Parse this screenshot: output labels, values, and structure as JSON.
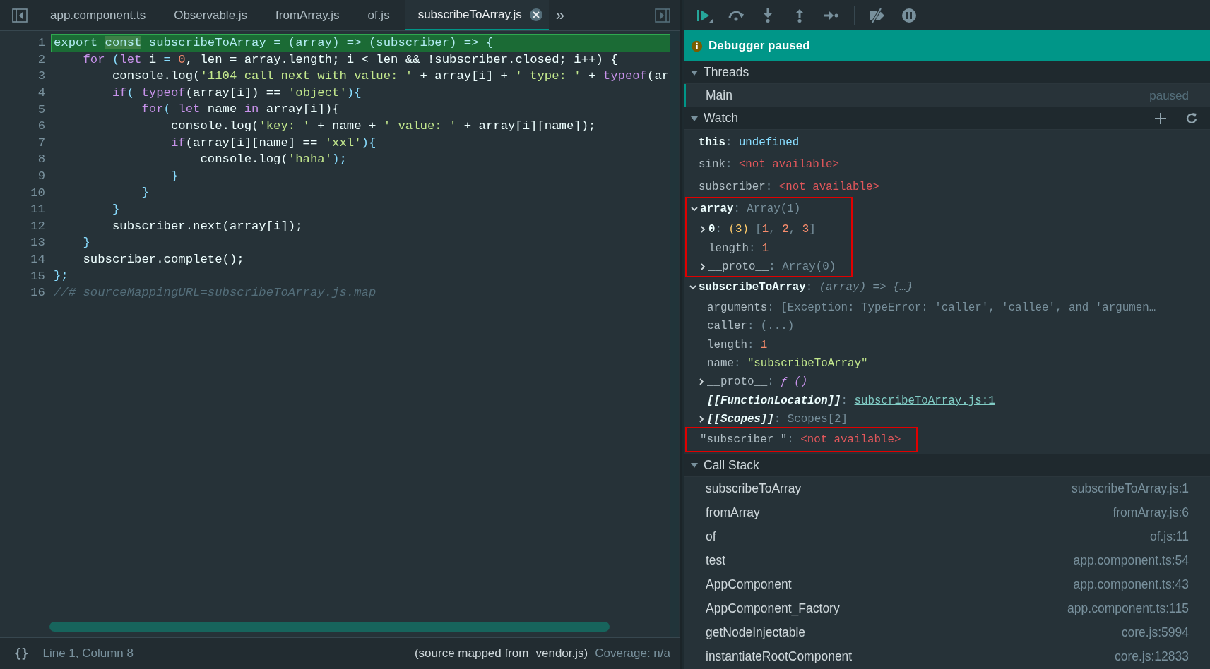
{
  "tabs": [
    {
      "label": "app.component.ts",
      "selected": false
    },
    {
      "label": "Observable.js",
      "selected": false
    },
    {
      "label": "fromArray.js",
      "selected": false
    },
    {
      "label": "of.js",
      "selected": false
    },
    {
      "label": "subscribeToArray.js",
      "selected": true
    }
  ],
  "tabs_overflow": "»",
  "code": [
    {
      "n": "1",
      "current": true,
      "tokens": [
        {
          "t": "export ",
          "kind": "keyword",
          "hl": false
        },
        {
          "t": "const",
          "kind": "keyword",
          "hl": true
        },
        {
          "t": " subscribeToArray ",
          "kind": "plain",
          "hl": false
        },
        {
          "t": "=",
          "kind": "punct",
          "hl": false
        },
        {
          "t": " (",
          "kind": "punct",
          "hl": false
        },
        {
          "t": "array",
          "kind": "plain",
          "hl": false
        },
        {
          "t": ") => (",
          "kind": "punct",
          "hl": false
        },
        {
          "t": "subscriber",
          "kind": "plain",
          "hl": false
        },
        {
          "t": ") => {",
          "kind": "punct",
          "hl": false
        }
      ]
    },
    {
      "n": "2",
      "current": false,
      "tokens": [
        {
          "t": "    for",
          "kind": "keyword"
        },
        {
          "t": " (",
          "kind": "punct"
        },
        {
          "t": "let",
          "kind": "keyword"
        },
        {
          "t": " i ",
          "kind": "plain"
        },
        {
          "t": "= ",
          "kind": "punct"
        },
        {
          "t": "0",
          "kind": "number"
        },
        {
          "t": ", len = array.length; i < len && !subscriber.closed; i++) {",
          "kind": "plain"
        }
      ]
    },
    {
      "n": "3",
      "current": false,
      "tokens": [
        {
          "t": "        console.log(",
          "kind": "plain"
        },
        {
          "t": "'1104 call next with value: '",
          "kind": "string"
        },
        {
          "t": " + array[i] + ",
          "kind": "plain"
        },
        {
          "t": "' type: '",
          "kind": "string"
        },
        {
          "t": " + ",
          "kind": "plain"
        },
        {
          "t": "typeof",
          "kind": "keyword"
        },
        {
          "t": "(ar",
          "kind": "plain"
        }
      ]
    },
    {
      "n": "4",
      "current": false,
      "tokens": [
        {
          "t": "        if",
          "kind": "keyword"
        },
        {
          "t": "( ",
          "kind": "punct"
        },
        {
          "t": "typeof",
          "kind": "keyword"
        },
        {
          "t": "(array[i]) == ",
          "kind": "plain"
        },
        {
          "t": "'object'",
          "kind": "string"
        },
        {
          "t": "){",
          "kind": "punct"
        }
      ]
    },
    {
      "n": "5",
      "current": false,
      "tokens": [
        {
          "t": "            for",
          "kind": "keyword"
        },
        {
          "t": "( ",
          "kind": "punct"
        },
        {
          "t": "let",
          "kind": "keyword"
        },
        {
          "t": " name ",
          "kind": "plain"
        },
        {
          "t": "in",
          "kind": "keyword"
        },
        {
          "t": " array[i]){",
          "kind": "plain"
        }
      ]
    },
    {
      "n": "6",
      "current": false,
      "tokens": [
        {
          "t": "                console.log(",
          "kind": "plain"
        },
        {
          "t": "'key: '",
          "kind": "string"
        },
        {
          "t": " + name + ",
          "kind": "plain"
        },
        {
          "t": "' value: '",
          "kind": "string"
        },
        {
          "t": " + array[i][name]);",
          "kind": "plain"
        }
      ]
    },
    {
      "n": "7",
      "current": false,
      "tokens": [
        {
          "t": "                if",
          "kind": "keyword"
        },
        {
          "t": "(array[i][name] == ",
          "kind": "plain"
        },
        {
          "t": "'xxl'",
          "kind": "string"
        },
        {
          "t": "){",
          "kind": "punct"
        }
      ]
    },
    {
      "n": "8",
      "current": false,
      "tokens": [
        {
          "t": "                    console.log(",
          "kind": "plain"
        },
        {
          "t": "'haha'",
          "kind": "string"
        },
        {
          "t": ");",
          "kind": "punct"
        }
      ]
    },
    {
      "n": "9",
      "current": false,
      "tokens": [
        {
          "t": "                }",
          "kind": "punct"
        }
      ]
    },
    {
      "n": "10",
      "current": false,
      "tokens": [
        {
          "t": "            }",
          "kind": "punct"
        }
      ]
    },
    {
      "n": "11",
      "current": false,
      "tokens": [
        {
          "t": "        }",
          "kind": "punct"
        }
      ]
    },
    {
      "n": "12",
      "current": false,
      "tokens": [
        {
          "t": "        subscriber.next(array[i]);",
          "kind": "plain"
        }
      ]
    },
    {
      "n": "13",
      "current": false,
      "tokens": [
        {
          "t": "    }",
          "kind": "punct"
        }
      ]
    },
    {
      "n": "14",
      "current": false,
      "tokens": [
        {
          "t": "    subscriber.complete();",
          "kind": "plain"
        }
      ]
    },
    {
      "n": "15",
      "current": false,
      "tokens": [
        {
          "t": "};",
          "kind": "punct"
        }
      ]
    },
    {
      "n": "16",
      "current": false,
      "tokens": [
        {
          "t": "//# sourceMappingURL=subscribeToArray.js.map",
          "kind": "comment"
        }
      ]
    }
  ],
  "status_bar": {
    "pretty_print": "{}",
    "position": "Line 1, Column 8",
    "source_prefix": "(source mapped from",
    "source_link": "vendor.js",
    "source_suffix": ")",
    "coverage": "Coverage: n/a"
  },
  "banner": "Debugger paused",
  "threads": {
    "title": "Threads",
    "expanded": true,
    "items": [
      {
        "name": "Main",
        "status": "paused",
        "selected": true
      }
    ]
  },
  "watch": {
    "title": "Watch",
    "expanded": true,
    "items": [
      {
        "name": "this",
        "kind": "available",
        "sep": ":",
        "highlighted": false,
        "value": [
          {
            "t": "undefined",
            "kind": "undefined"
          }
        ]
      },
      {
        "name": "sink",
        "kind": "unavailable",
        "sep": ":",
        "highlighted": false,
        "value": [
          {
            "t": "<not available>",
            "kind": "error"
          }
        ]
      },
      {
        "name": "subscriber",
        "kind": "unavailable",
        "sep": ":",
        "highlighted": false,
        "value": [
          {
            "t": "<not available>",
            "kind": "error"
          }
        ]
      },
      {
        "name": "array",
        "kind": "available",
        "sep": ":",
        "expanded": true,
        "highlighted": true,
        "value": [
          {
            "t": "Array(1)",
            "kind": "dim"
          }
        ],
        "children": [
          {
            "name": "0",
            "kind": "enumerable",
            "sep": ":",
            "expanded": false,
            "value": [
              {
                "t": "(3)",
                "kind": "count"
              },
              {
                "t": "[",
                "kind": "dim"
              },
              {
                "t": "1",
                "kind": "number"
              },
              {
                "t": ",",
                "kind": "comma"
              },
              {
                "t": "2",
                "kind": "number"
              },
              {
                "t": ",",
                "kind": "comma"
              },
              {
                "t": "3",
                "kind": "number"
              },
              {
                "t": "]",
                "kind": "dim"
              }
            ]
          },
          {
            "name": "length",
            "kind": "hidden",
            "sep": ":",
            "value": [
              {
                "t": "1",
                "kind": "number"
              }
            ]
          },
          {
            "name": "__proto__",
            "kind": "hidden",
            "sep": ":",
            "expanded": false,
            "value": [
              {
                "t": "Array(0)",
                "kind": "dim"
              }
            ]
          }
        ]
      },
      {
        "name": "subscribeToArray",
        "kind": "available",
        "sep": ":",
        "expanded": true,
        "highlighted": false,
        "value": [
          {
            "t": "(array) => {…}",
            "kind": "function"
          }
        ],
        "children": [
          {
            "name": "arguments",
            "kind": "hidden",
            "sep": ":",
            "value": [
              {
                "t": "[Exception: TypeError: 'caller', 'callee', and 'argumen…",
                "kind": "dim"
              }
            ]
          },
          {
            "name": "caller",
            "kind": "hidden",
            "sep": ":",
            "value": [
              {
                "t": "(...)",
                "kind": "dim"
              }
            ]
          },
          {
            "name": "length",
            "kind": "hidden",
            "sep": ":",
            "value": [
              {
                "t": "1",
                "kind": "number"
              }
            ]
          },
          {
            "name": "name",
            "kind": "hidden",
            "sep": ":",
            "value": [
              {
                "t": "\"subscribeToArray\"",
                "kind": "string"
              }
            ]
          },
          {
            "name": "__proto__",
            "kind": "hidden",
            "sep": ":",
            "expanded": false,
            "value": [
              {
                "t": "ƒ ()",
                "kind": "fsymbol"
              }
            ]
          },
          {
            "name": "[[FunctionLocation]]",
            "kind": "internal",
            "sep": ":",
            "value": [
              {
                "t": "subscribeToArray.js:1",
                "kind": "link"
              }
            ]
          },
          {
            "name": "[[Scopes]]",
            "kind": "internal",
            "sep": ":",
            "expanded": false,
            "value": [
              {
                "t": "Scopes[2]",
                "kind": "dim"
              }
            ]
          }
        ]
      },
      {
        "name": "\"subscriber \"",
        "kind": "unavailable",
        "sep": ":",
        "highlighted": true,
        "value": [
          {
            "t": "<not available>",
            "kind": "error"
          }
        ]
      }
    ]
  },
  "call_stack": {
    "title": "Call Stack",
    "expanded": true,
    "frames": [
      {
        "name": "subscribeToArray",
        "location": "subscribeToArray.js:1"
      },
      {
        "name": "fromArray",
        "location": "fromArray.js:6"
      },
      {
        "name": "of",
        "location": "of.js:11"
      },
      {
        "name": "test",
        "location": "app.component.ts:54"
      },
      {
        "name": "AppComponent",
        "location": "app.component.ts:43"
      },
      {
        "name": "AppComponent_Factory",
        "location": "app.component.ts:115"
      },
      {
        "name": "getNodeInjectable",
        "location": "core.js:5994"
      },
      {
        "name": "instantiateRootComponent",
        "location": "core.js:12833"
      }
    ]
  }
}
